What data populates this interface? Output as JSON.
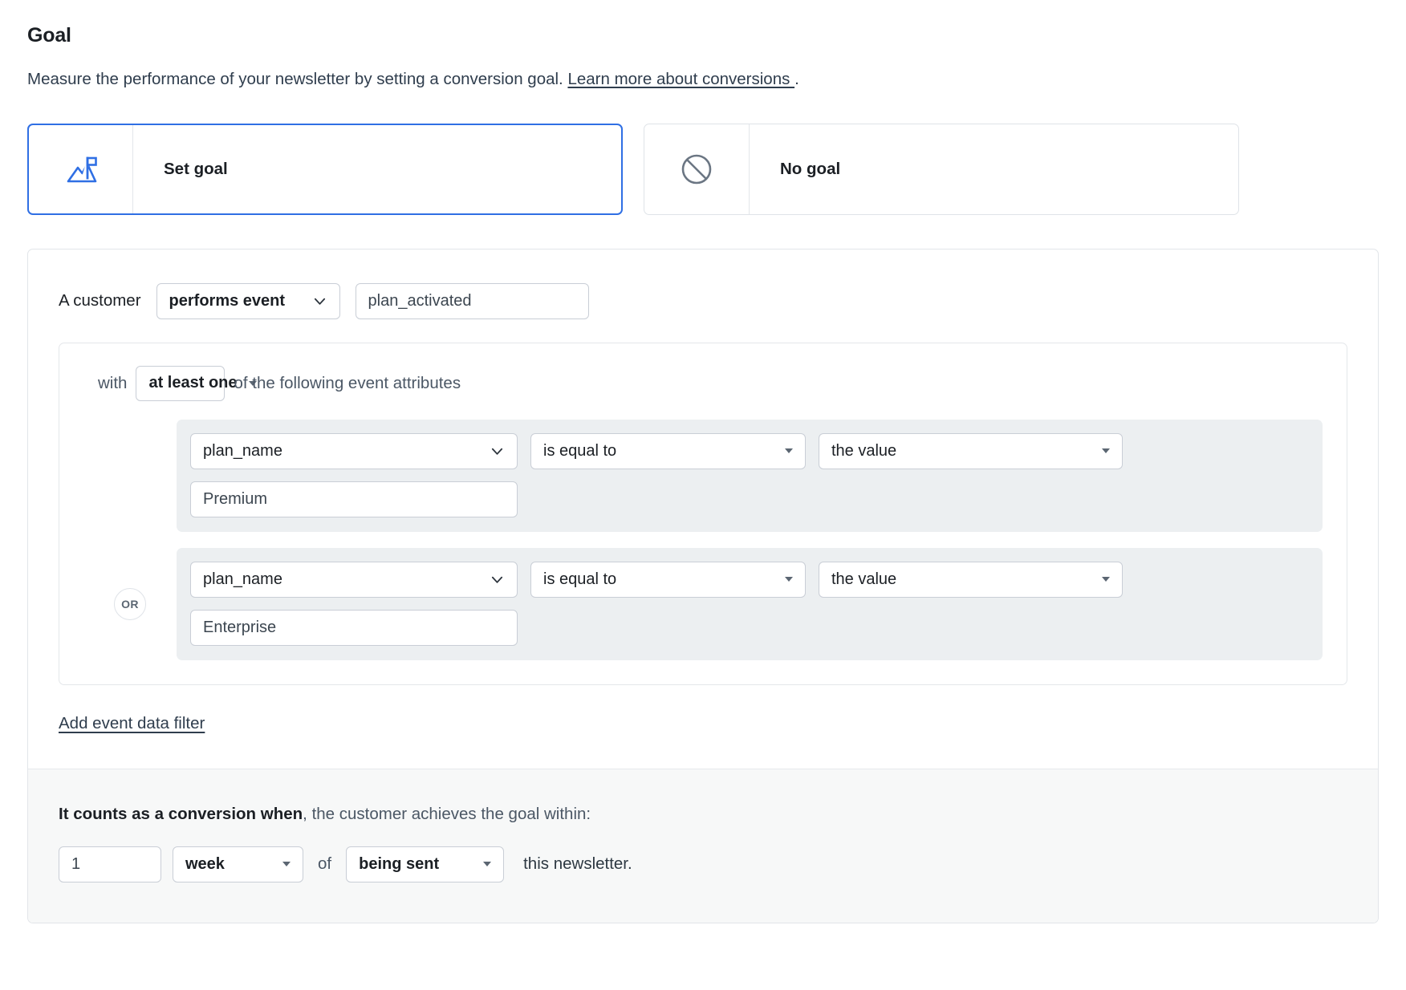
{
  "heading": {
    "title": "Goal",
    "description_before": "Measure the performance of your newsletter by setting a conversion goal.",
    "link_text": "Learn more about conversions ",
    "description_after": "."
  },
  "options": [
    {
      "id": "set-goal",
      "label": "Set goal",
      "icon": "mountain-flag-icon",
      "selected": true
    },
    {
      "id": "no-goal",
      "label": "No goal",
      "icon": "no-entry-icon",
      "selected": false
    }
  ],
  "builder": {
    "lead_label": "A customer",
    "event_mode": {
      "value": "performs event",
      "icon": "chevron-down-icon"
    },
    "event_name": {
      "value": "plan_activated"
    },
    "attributes": {
      "prefix_label": "with",
      "quantifier": {
        "value": "at least one",
        "icon": "caret-down-icon"
      },
      "suffix_label": "of the following event attributes",
      "or_badge": "OR",
      "conditions": [
        {
          "attribute": "plan_name",
          "operator": "is equal to",
          "value_type": "the value",
          "value": "Premium"
        },
        {
          "attribute": "plan_name",
          "operator": "is equal to",
          "value_type": "the value",
          "value": "Enterprise"
        }
      ]
    },
    "add_filter_label": "Add event data filter"
  },
  "footer": {
    "bold_text": "It counts as a conversion when",
    "rest_text": ", the customer achieves the goal within:",
    "amount": "1",
    "unit": "week",
    "joiner": "of",
    "trigger": "being sent",
    "tail": "this newsletter."
  },
  "colors": {
    "accent": "#2f6fe4",
    "panel_border": "#e2e5e9",
    "condition_bg": "#eceff1",
    "footer_bg": "#f7f8f8",
    "muted_text": "#4b5765"
  }
}
